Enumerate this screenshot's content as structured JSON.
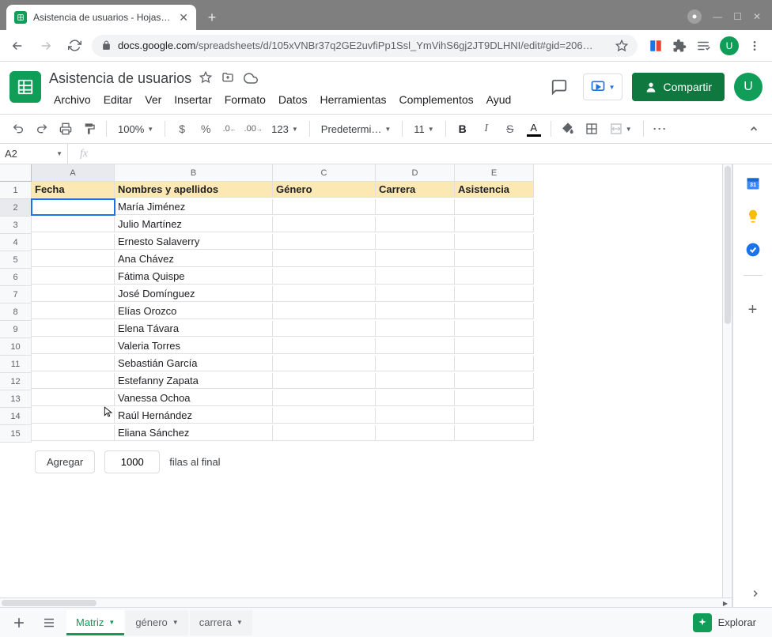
{
  "browser": {
    "tab_title": "Asistencia de usuarios - Hojas de",
    "url_domain": "docs.google.com",
    "url_path": "/spreadsheets/d/105xVNBr37q2GE2uvfiPp1Ssl_YmVihS6gj2JT9DLHNI/edit#gid=206…",
    "avatar_letter": "U"
  },
  "doc": {
    "title": "Asistencia de usuarios",
    "menus": [
      "Archivo",
      "Editar",
      "Ver",
      "Insertar",
      "Formato",
      "Datos",
      "Herramientas",
      "Complementos",
      "Ayud"
    ],
    "share_label": "Compartir",
    "avatar_letter": "U"
  },
  "toolbar": {
    "zoom": "100%",
    "currency": "$",
    "percent": "%",
    "dec_dec": ".0",
    "dec_inc": ".00",
    "num_format": "123",
    "font": "Predetermi…",
    "font_size": "11",
    "more": "⋯"
  },
  "name_box": "A2",
  "columns": [
    "A",
    "B",
    "C",
    "D",
    "E"
  ],
  "rows_count": 15,
  "header_row": [
    "Fecha",
    "Nombres y apellidos",
    "Género",
    "Carrera",
    "Asistencia"
  ],
  "data_rows": [
    [
      "",
      "María Jiménez",
      "",
      "",
      ""
    ],
    [
      "",
      "Julio Martínez",
      "",
      "",
      ""
    ],
    [
      "",
      "Ernesto Salaverry",
      "",
      "",
      ""
    ],
    [
      "",
      "Ana Chávez",
      "",
      "",
      ""
    ],
    [
      "",
      "Fátima Quispe",
      "",
      "",
      ""
    ],
    [
      "",
      "José Domínguez",
      "",
      "",
      ""
    ],
    [
      "",
      "Elías Orozco",
      "",
      "",
      ""
    ],
    [
      "",
      "Elena Távara",
      "",
      "",
      ""
    ],
    [
      "",
      "Valeria Torres",
      "",
      "",
      ""
    ],
    [
      "",
      "Sebastián García",
      "",
      "",
      ""
    ],
    [
      "",
      "Estefanny Zapata",
      "",
      "",
      ""
    ],
    [
      "",
      "Vanessa Ochoa",
      "",
      "",
      ""
    ],
    [
      "",
      "Raúl Hernández",
      "",
      "",
      ""
    ],
    [
      "",
      "Eliana Sánchez",
      "",
      "",
      ""
    ]
  ],
  "add_rows": {
    "button": "Agregar",
    "value": "1000",
    "suffix": "filas al final"
  },
  "sheet_tabs": [
    {
      "label": "Matriz",
      "active": true
    },
    {
      "label": "género",
      "active": false
    },
    {
      "label": "carrera",
      "active": false
    }
  ],
  "explore_label": "Explorar"
}
